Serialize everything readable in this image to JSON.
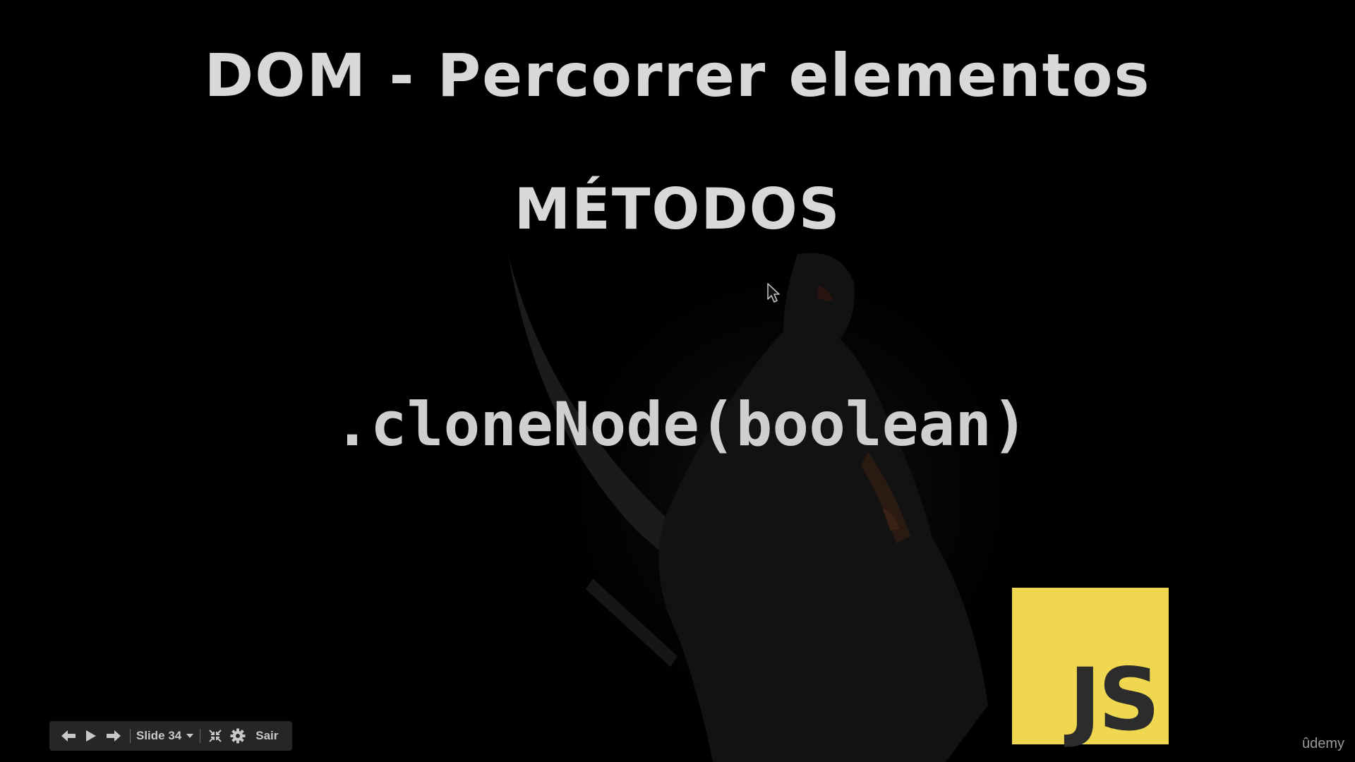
{
  "slide": {
    "title": "DOM - Percorrer elementos",
    "subtitle": "MÉTODOS",
    "code": ".cloneNode(boolean)",
    "logo_text": "JS",
    "logo_color": "#efd84f"
  },
  "controls": {
    "prev_icon": "arrow-left-icon",
    "play_icon": "play-icon",
    "next_icon": "arrow-right-icon",
    "slide_label": "Slide 34",
    "dropdown_icon": "caret-down-icon",
    "exit_fullscreen_icon": "exit-fullscreen-icon",
    "settings_icon": "gear-icon",
    "exit_label": "Sair"
  },
  "watermark": {
    "text": "ûdemy"
  }
}
